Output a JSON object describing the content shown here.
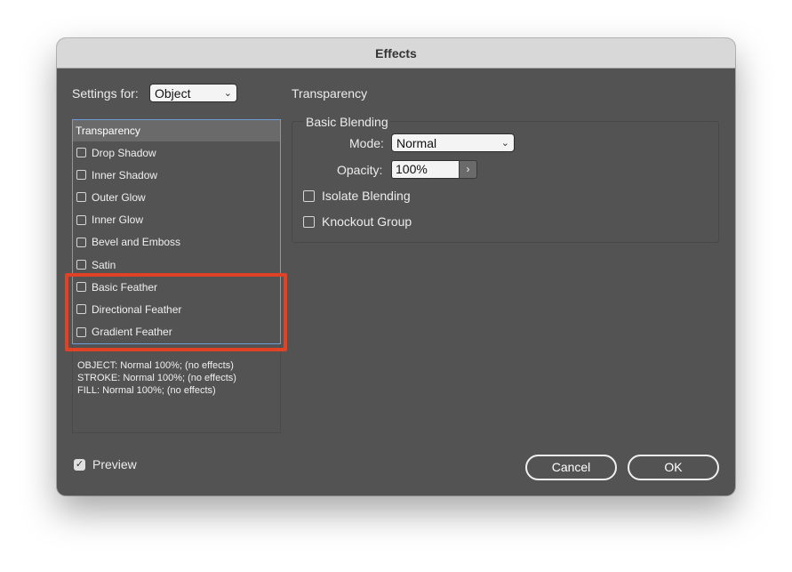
{
  "dialog": {
    "title": "Effects",
    "settings_for": {
      "label": "Settings for:",
      "value": "Object"
    },
    "effects_list": {
      "header": "Transparency",
      "items": [
        {
          "label": "Drop Shadow",
          "checked": false
        },
        {
          "label": "Inner Shadow",
          "checked": false
        },
        {
          "label": "Outer Glow",
          "checked": false
        },
        {
          "label": "Inner Glow",
          "checked": false
        },
        {
          "label": "Bevel and Emboss",
          "checked": false
        },
        {
          "label": "Satin",
          "checked": false
        },
        {
          "label": "Basic Feather",
          "checked": false
        },
        {
          "label": "Directional Feather",
          "checked": false
        },
        {
          "label": "Gradient Feather",
          "checked": false
        }
      ]
    },
    "summary": [
      "OBJECT: Normal 100%; (no effects)",
      "STROKE: Normal 100%; (no effects)",
      "FILL: Normal 100%; (no effects)"
    ],
    "panel": {
      "title": "Transparency",
      "group_title": "Basic Blending",
      "mode": {
        "label": "Mode:",
        "value": "Normal"
      },
      "opacity": {
        "label": "Opacity:",
        "value": "100%"
      },
      "isolate_blending": "Isolate Blending",
      "knockout_group": "Knockout Group"
    },
    "preview": {
      "label": "Preview",
      "checked": true
    },
    "buttons": {
      "cancel": "Cancel",
      "ok": "OK"
    },
    "highlight_color": "#e04226"
  }
}
